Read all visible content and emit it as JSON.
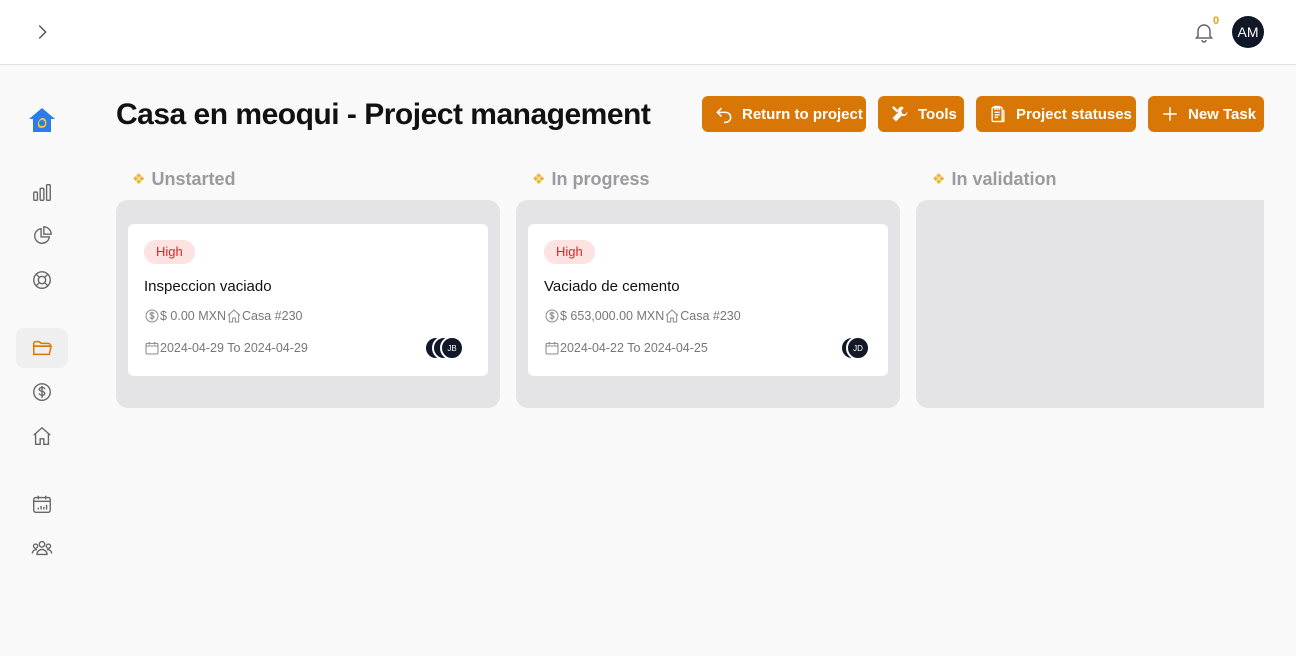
{
  "topbar": {
    "notification_count": "0",
    "user_initials": "AM"
  },
  "page": {
    "title": "Casa en meoqui - Project management"
  },
  "actions": {
    "return_label": "Return to project",
    "tools_label": "Tools",
    "statuses_label": "Project statuses",
    "new_task_label": "New Task"
  },
  "columns": [
    {
      "title": "Unstarted"
    },
    {
      "title": "In progress"
    },
    {
      "title": "In validation"
    }
  ],
  "cards": [
    {
      "priority": "High",
      "name": "Inspeccion vaciado",
      "amount": "$ 0.00 MXN",
      "unit": "Casa #230",
      "dates": "2024-04-29 To 2024-04-29",
      "assignee_initials": "JB"
    },
    {
      "priority": "High",
      "name": "Vaciado de cemento",
      "amount": "$ 653,000.00 MXN",
      "unit": "Casa #230",
      "dates": "2024-04-22 To 2024-04-25",
      "assignee_initials": "JD"
    }
  ],
  "icons": {
    "expand": "chevron-right-icon",
    "notifications": "bell-icon",
    "sidebar": [
      "bar-chart-icon",
      "pie-chart-icon",
      "lifebuoy-icon",
      "folder-icon",
      "dollar-icon",
      "home-icon",
      "calendar-icon",
      "users-icon"
    ]
  },
  "colors": {
    "accent": "#d97706",
    "priority_bg": "#fde2e2",
    "priority_text": "#dc2626",
    "column_bg": "#e4e4e7",
    "column_title": "#9a9aa0"
  }
}
